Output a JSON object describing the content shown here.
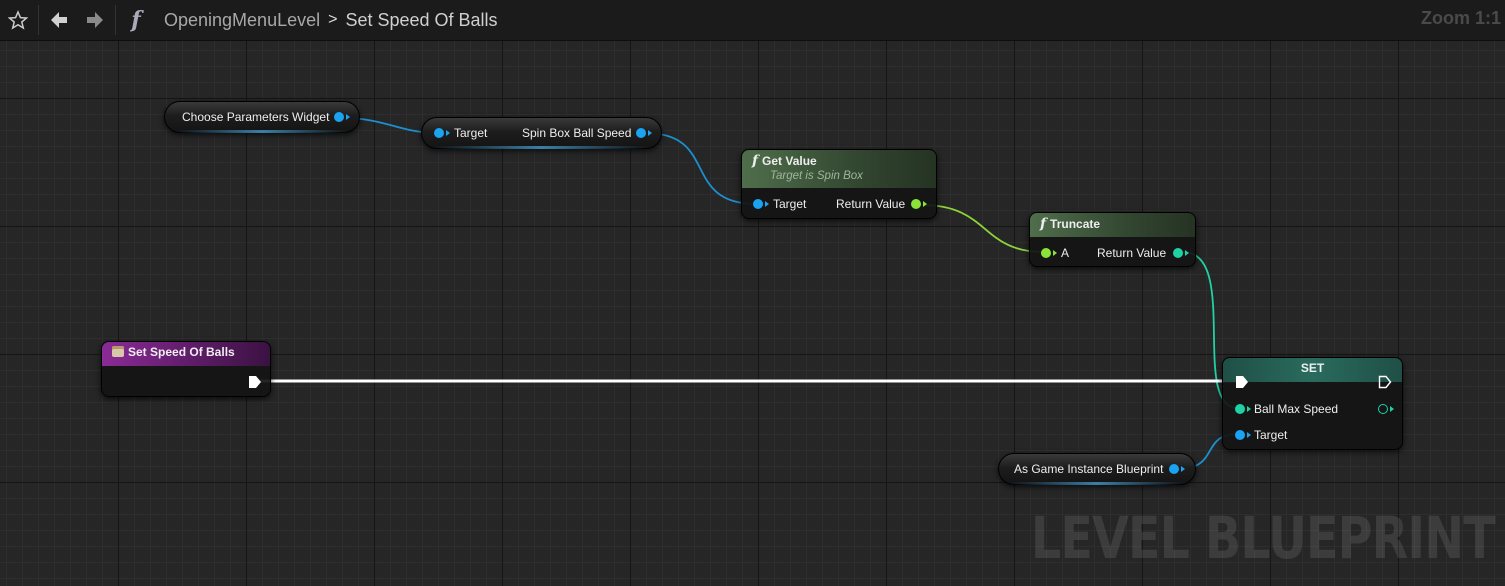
{
  "toolbar": {
    "function_glyph": "f",
    "breadcrumb": [
      "OpeningMenuLevel",
      "Set Speed Of Balls"
    ],
    "breadcrumb_separator": ">",
    "zoom": "Zoom 1:1"
  },
  "nodes": {
    "choose_params": {
      "label": "Choose Parameters Widget"
    },
    "spin_box": {
      "input": "Target",
      "output": "Spin Box Ball Speed"
    },
    "get_value": {
      "title": "Get Value",
      "subtitle": "Target is Spin Box",
      "input": "Target",
      "output": "Return Value"
    },
    "truncate": {
      "title": "Truncate",
      "input": "A",
      "output": "Return Value"
    },
    "event": {
      "title": "Set Speed Of Balls"
    },
    "set": {
      "title": "SET",
      "input_1": "Ball Max Speed",
      "input_2": "Target"
    },
    "game_instance": {
      "label": "As Game Instance Blueprint"
    }
  },
  "watermark": "LEVEL BLUEPRINT",
  "colors": {
    "object_pin": "#1aa3f0",
    "float_pin": "#8be33a",
    "int_pin": "#1fd1a4",
    "function_header": "#3f5a3c",
    "event_header": "#6e1e7a"
  }
}
